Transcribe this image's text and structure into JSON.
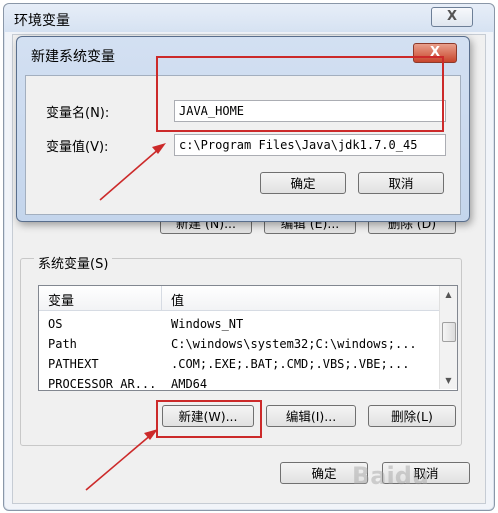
{
  "outer": {
    "title": "环境变量",
    "close_label": "X",
    "user_buttons": {
      "new": "新建 (N)...",
      "edit": "编辑 (E)...",
      "delete": "删除 (D)"
    },
    "system_group_label": "系统变量(S)",
    "columns": [
      "变量",
      "值"
    ],
    "rows": [
      {
        "name": "OS",
        "value": "Windows_NT"
      },
      {
        "name": "Path",
        "value": "C:\\windows\\system32;C:\\windows;..."
      },
      {
        "name": "PATHEXT",
        "value": ".COM;.EXE;.BAT;.CMD;.VBS;.VBE;..."
      },
      {
        "name": "PROCESSOR_AR...",
        "value": "AMD64"
      }
    ],
    "system_buttons": {
      "new": "新建(W)...",
      "edit": "编辑(I)...",
      "delete": "删除(L)"
    },
    "ok": "确定",
    "cancel": "取消"
  },
  "inner": {
    "title": "新建系统变量",
    "close_label": "X",
    "name_label": "变量名(N):",
    "name_value": "JAVA_HOME",
    "value_label": "变量值(V):",
    "value_value": "c:\\Program Files\\Java\\jdk1.7.0_45",
    "ok": "确定",
    "cancel": "取消"
  },
  "watermark": "Baidu",
  "colors": {
    "annotation": "#cc2a2a",
    "dialog_frame": "#c4d5ec"
  }
}
